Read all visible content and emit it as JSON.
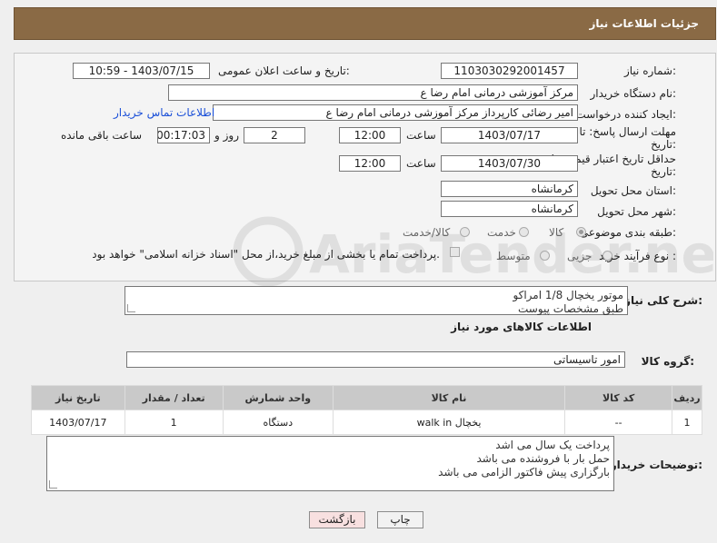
{
  "header": {
    "title": "جزئیات اطلاعات نیاز"
  },
  "form": {
    "need_number_label": "شماره نیاز:",
    "need_number": "1103030292001457",
    "announce_label": "تاریخ و ساعت اعلان عمومی:",
    "announce_value": "1403/07/15 - 10:59",
    "buyer_org_label": "نام دستگاه خریدار:",
    "buyer_org": "مرکز آموزشی  درمانی امام رضا  ع",
    "requester_label": "ایجاد کننده درخواست:",
    "requester": "امیر رضائی کارپرداز مرکز آموزشی  درمانی امام رضا  ع",
    "contact_link": "اطلاعات تماس خریدار",
    "reply_deadline_label_1": "مهلت ارسال پاسخ: تا",
    "reply_deadline_label_2": "تاریخ:",
    "reply_date": "1403/07/17",
    "time_label": "ساعت",
    "reply_time": "12:00",
    "days_value": "2",
    "days_label": "روز و",
    "remaining_value": "00:17:03",
    "remaining_label": "ساعت باقی مانده",
    "validity_label_1": "حداقل تاریخ اعتبار قیمت: تا",
    "validity_label_2": "تاریخ:",
    "validity_date": "1403/07/30",
    "validity_time": "12:00",
    "province_label": "استان محل تحویل:",
    "province": "کرمانشاه",
    "city_label": "شهر محل تحویل:",
    "city": "کرمانشاه",
    "category_label": "طبقه بندی موضوعی:",
    "category_options": [
      "کالا",
      "خدمت",
      "کالا/خدمت"
    ],
    "process_label": "نوع فرآیند خرید :",
    "process_options": [
      "جزیی",
      "متوسط"
    ],
    "payment_note": "پرداخت تمام یا بخشی از مبلغ خرید،از محل \"اسناد خزانه اسلامی\" خواهد بود."
  },
  "description": {
    "label": "شرح کلی نیاز:",
    "lines": [
      "موتور یخچال 1/8 امراکو",
      "طبق مشخصات پیوست"
    ]
  },
  "goods": {
    "section_title": "اطلاعات کالاهای مورد نیاز",
    "group_label": "گروه کالا:",
    "group_value": "امور تاسیساتی",
    "columns": [
      "ردیف",
      "کد کالا",
      "نام کالا",
      "واحد شمارش",
      "تعداد / مقدار",
      "تاریخ نیاز"
    ],
    "rows": [
      [
        "1",
        "--",
        "یخچال walk in",
        "دستگاه",
        "1",
        "1403/07/17"
      ]
    ]
  },
  "buyer_notes": {
    "label": "توضیحات خریدار:",
    "lines": [
      "پرداخت یک سال می اشد",
      "حمل بار با فروشنده می باشد",
      "بارگزاری پیش فاکتور الزامی می باشد"
    ]
  },
  "buttons": {
    "print": "چاپ",
    "back": "بازگشت"
  },
  "watermark": {
    "text": "AriaTender.neT"
  },
  "colors": {
    "header_bg": "#8a6a45",
    "link": "#1a4fd8",
    "back_btn_bg": "#f8e0e0"
  }
}
